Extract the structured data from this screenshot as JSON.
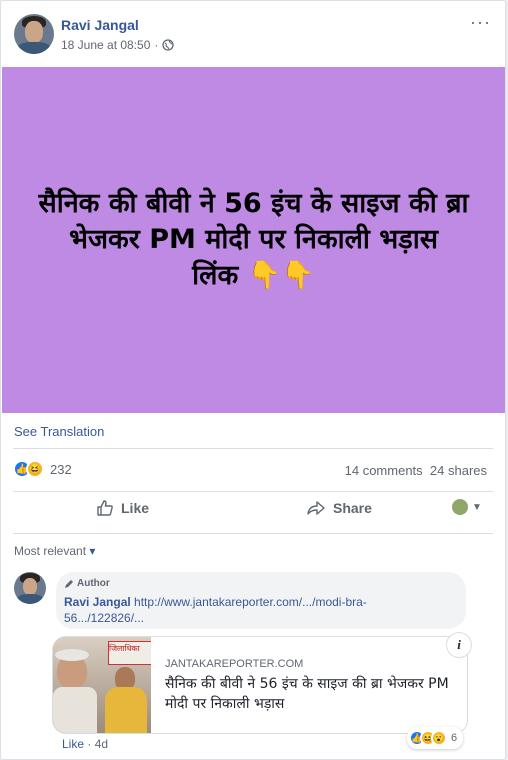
{
  "post": {
    "author": "Ravi Jangal",
    "timestamp": "18 June at 08:50",
    "meta_separator": "·",
    "more_label": "···",
    "banner": {
      "line1": "सैनिक की बीवी ने 56 इंच के साइज की ब्रा भेजकर PM मोदी पर निकाली भड़ास",
      "line2": "लिंक",
      "emoji": "👇👇",
      "background": "#bf8ae4"
    },
    "see_translation": "See Translation",
    "reaction_count": "232",
    "comments_count": "14 comments",
    "shares_count": "24 shares",
    "actions": {
      "like": "Like",
      "share": "Share"
    }
  },
  "comments": {
    "sort_label": "Most relevant",
    "sort_caret": "▾",
    "items": [
      {
        "badge": "Author",
        "name": "Ravi Jangal",
        "text": "http://www.jantakareporter.com/.../modi-bra-56.../122826/...",
        "preview": {
          "domain": "JANTAKAREPORTER.COM",
          "title": "सैनिक की बीवी ने 56 इंच के साइज की ब्रा भेजकर PM मोदी पर निकाली भड़ास",
          "thumb_text": "जिलाधिका",
          "info_label": "i"
        },
        "like_label": "Like",
        "age": "4d",
        "dot": "·",
        "reaction_count": "6"
      }
    ]
  },
  "colors": {
    "link_blue": "#385898",
    "like_blue": "#1877f2",
    "muted": "#606770"
  }
}
